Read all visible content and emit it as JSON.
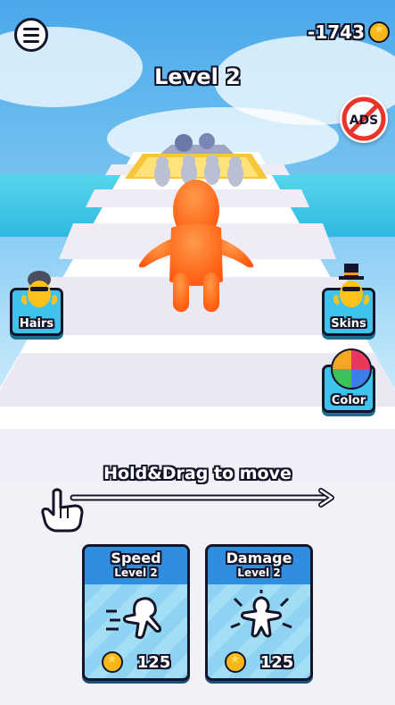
{
  "hud": {
    "menu_icon": "hamburger-menu-icon",
    "coins_value": "-1743",
    "coin_icon": "coin-star-icon",
    "level_title": "Level 2",
    "no_ads_label": "ADS"
  },
  "side_buttons": {
    "hairs": {
      "label": "Hairs",
      "icon": "character-hair-icon"
    },
    "skins": {
      "label": "Skins",
      "icon": "character-tophat-icon"
    },
    "color": {
      "label": "Color",
      "icon": "color-wheel-icon"
    }
  },
  "tutorial": {
    "hint": "Hold&Drag to move",
    "hand_icon": "pointing-hand-icon",
    "arrow_icon": "double-arrow-icon"
  },
  "upgrades": [
    {
      "title": "Speed",
      "level": "Level 2",
      "price": "125",
      "icon": "running-character-icon"
    },
    {
      "title": "Damage",
      "level": "Level 2",
      "price": "125",
      "icon": "power-character-icon"
    }
  ],
  "colors": {
    "player": "#ff6a1a",
    "accent": "#3ec4ec",
    "outline": "#15152a",
    "coin": "#f7b718"
  }
}
